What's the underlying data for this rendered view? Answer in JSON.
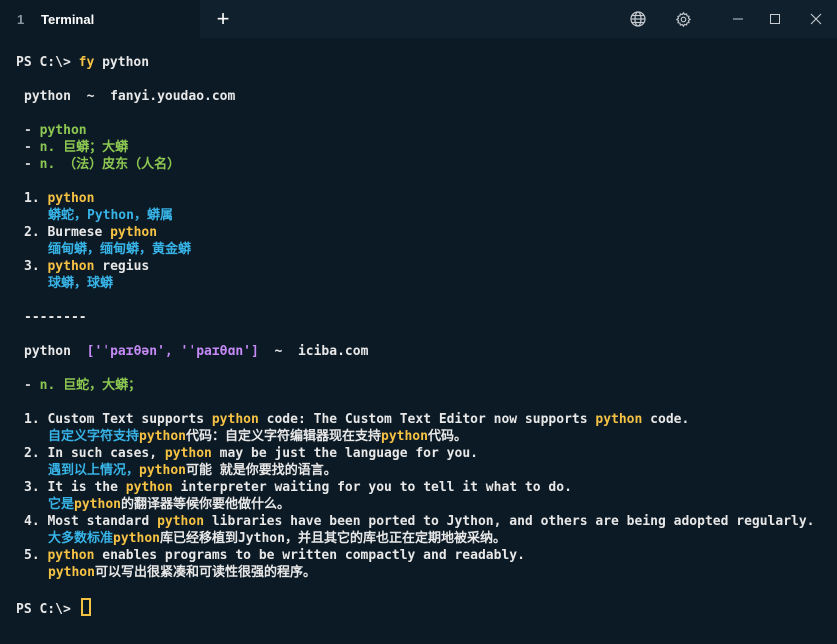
{
  "window": {
    "tab_index": "1",
    "tab_title": "Terminal",
    "new_tab_label": "+",
    "icons": [
      "globe-icon",
      "gear-icon",
      "minimize-icon",
      "maximize-icon",
      "close-icon"
    ]
  },
  "colors": {
    "background": "#0c1a25",
    "titlebar": "#10202d",
    "keyword": "#f6c244",
    "green": "#8cc751",
    "cyan": "#37b3e6",
    "purple": "#c58af5"
  },
  "terminal": {
    "prompt": "PS C:\\> ",
    "command_name": "fy",
    "command_arg": " python",
    "youdao": {
      "word": "python",
      "sep": "  ~  ",
      "source": "fanyi.youdao.com",
      "defs": [
        {
          "dash": "- ",
          "text": "python"
        },
        {
          "dash": "- ",
          "text": "n. 巨蟒；大蟒"
        },
        {
          "dash": "- ",
          "text": "n. （法）皮东（人名）"
        }
      ],
      "phrases": [
        {
          "num": "1. ",
          "pre": "",
          "hl": "python",
          "post": "",
          "trans": "蟒蛇，Python，蟒属"
        },
        {
          "num": "2. ",
          "pre": "Burmese ",
          "hl": "python",
          "post": "",
          "trans": "缅甸蟒，缅甸蟒，黄金蟒"
        },
        {
          "num": "3. ",
          "pre": "",
          "hl": "python",
          "post": " regius",
          "trans": "球蟒，球蟒"
        }
      ]
    },
    "divider": "--------",
    "iciba": {
      "word": "python",
      "phonetic": "['ˈpaɪθən', 'ˈpaɪθɑn']",
      "sep": "  ~  ",
      "source": "iciba.com",
      "def": {
        "dash": "- ",
        "text": "n. 巨蛇，大蟒；"
      },
      "examples": [
        {
          "num": "1. ",
          "en1": "Custom Text supports ",
          "en2": " code: The Custom Text Editor now supports ",
          "en3": " code.",
          "cn1": "自定义字符支持",
          "cn2": "代码：自定义字符编辑器现在支持",
          "cn3": "代码。"
        },
        {
          "num": "2. ",
          "en1": "In such cases, ",
          "en2": " may be just the language for you.",
          "cn1": "遇到以上情况，",
          "cn2": "可能 就是你要找的语言。"
        },
        {
          "num": "3. ",
          "en1": "It is the ",
          "en2": " interpreter waiting for you to tell it what to do.",
          "cn1": "它是",
          "cn2": "的翻译器等候你要他做什么。"
        },
        {
          "num": "4. ",
          "en1": "Most standard ",
          "en2": " libraries have been ported to Jython, and others are being adopted regularly.",
          "cn1": "大多数标准",
          "cn2": "库已经移植到Jython，并且其它的库也正在定期地被采纳。"
        },
        {
          "num": "5. ",
          "en1": "",
          "en2": " enables programs to be written compactly and readably.",
          "cn1": "",
          "cn2": "可以写出很紧凑和可读性很强的程序。"
        }
      ]
    },
    "highlight": "python"
  }
}
